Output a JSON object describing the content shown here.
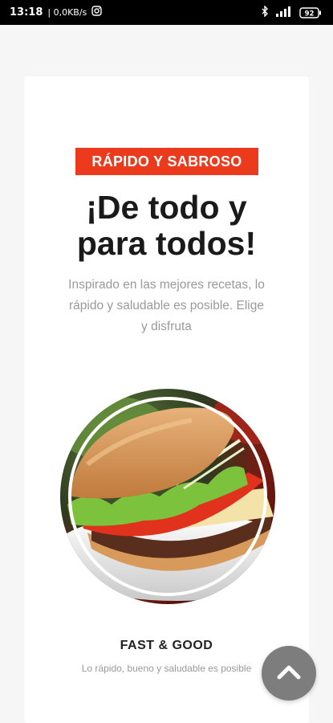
{
  "status_bar": {
    "time": "13:18",
    "net_speed": "| 0,0KB/s",
    "battery": "92"
  },
  "hero": {
    "badge": "RÁPIDO Y SABROSO",
    "title_line1": "¡De todo y",
    "title_line2": "para todos!",
    "description_line1": "Inspirado en las mejores recetas, lo",
    "description_line2": "rápido y saludable es posible. Elige",
    "description_line3": "y disfruta"
  },
  "feature": {
    "title": "FAST & GOOD",
    "text": "Lo rápido, bueno y saludable es posible"
  },
  "colors": {
    "accent": "#ec3a1c",
    "fab": "#7d7d7d"
  },
  "icons": {
    "scroll_top": "chevron-up-icon",
    "photo": "burger-photo"
  }
}
